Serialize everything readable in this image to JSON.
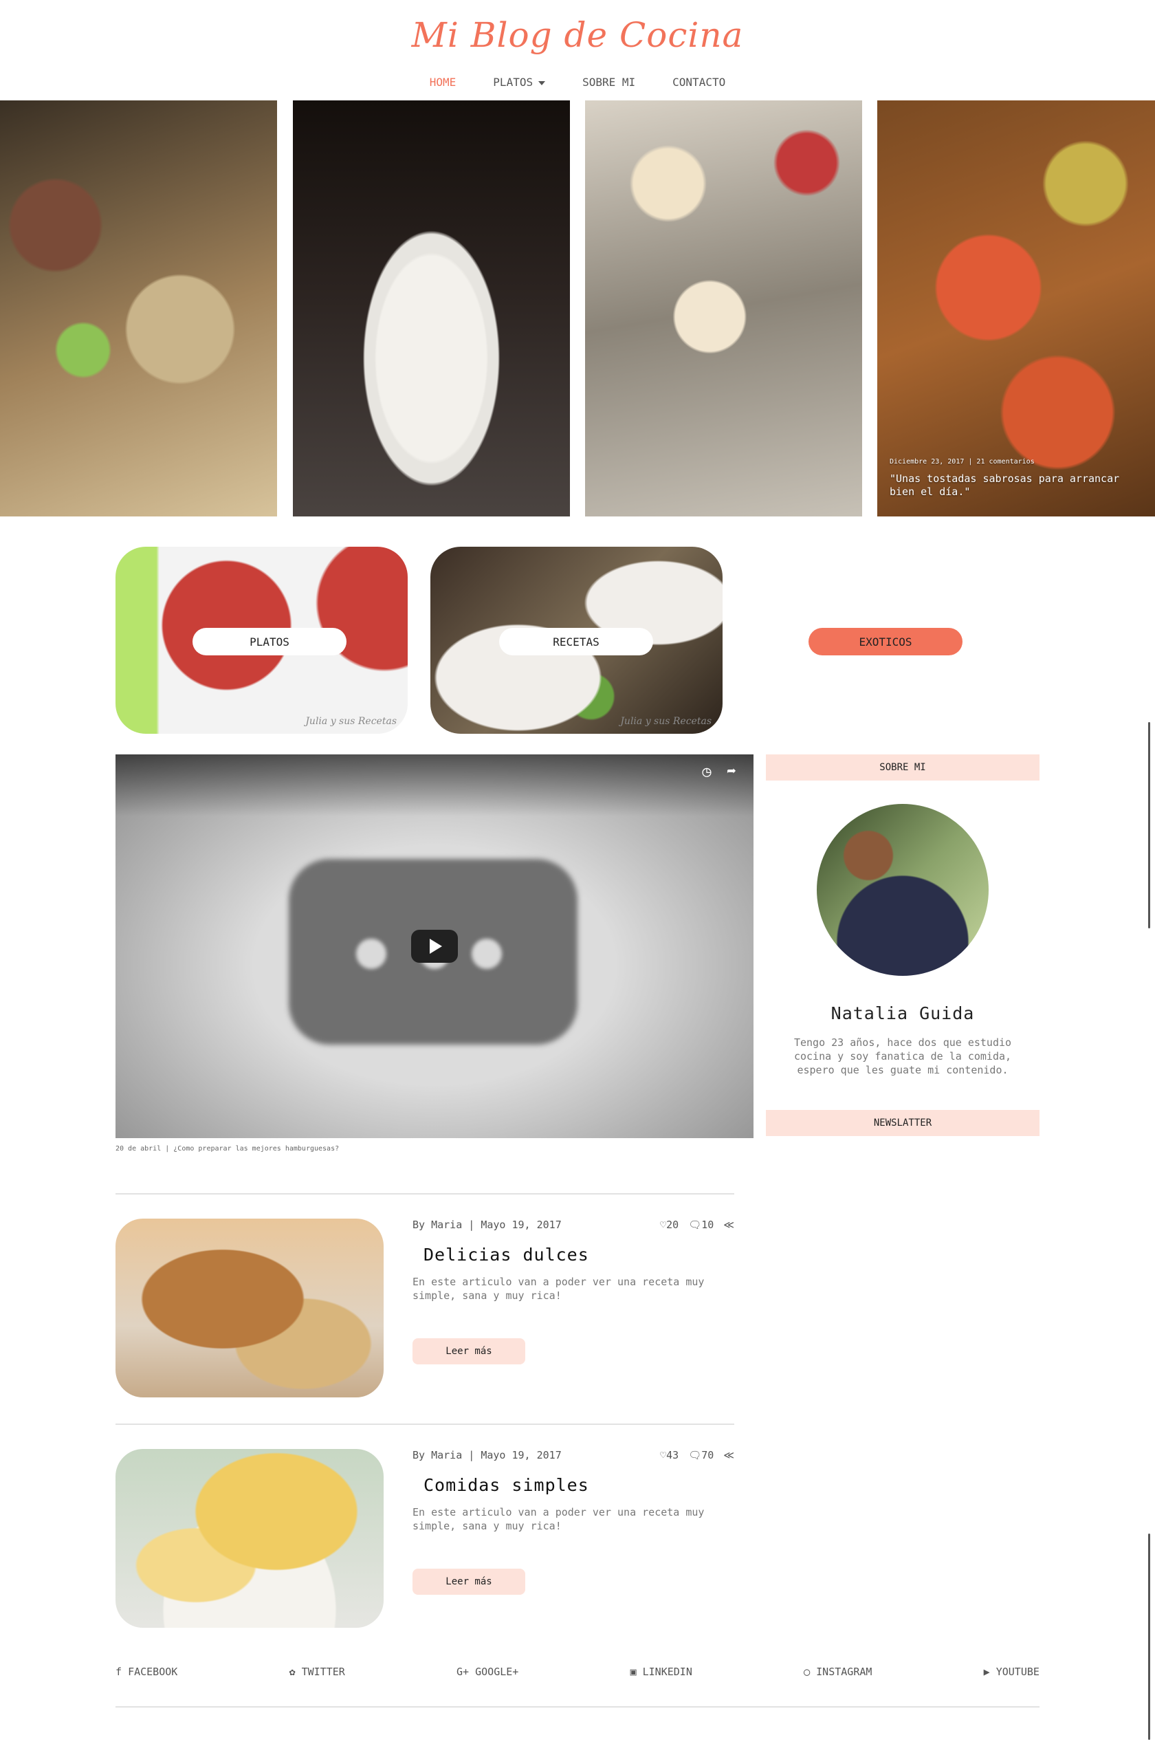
{
  "header": {
    "title": "Mi Blog de Cocina"
  },
  "nav": {
    "home": "HOME",
    "platos": "PLATOS",
    "sobre_mi": "SOBRE MI",
    "contacto": "CONTACTO"
  },
  "hero": {
    "caption_meta": "Diciembre 23, 2017 | 21 comentarios",
    "caption_quote": "\"Unas tostadas sabrosas para arrancar bien el día.\""
  },
  "categories": {
    "platos": "PLATOS",
    "recetas": "RECETAS",
    "exoticos": "EXOTICOS",
    "signature": "Julia y sus Recetas"
  },
  "video": {
    "caption": "20 de abril | ¿Como preparar las mejores hamburguesas?"
  },
  "sidebar": {
    "about_heading": "SOBRE MI",
    "author_name": "Natalia Guida",
    "author_bio": "Tengo 23 años, hace dos que estudio cocina y soy fanatica de la comida, espero que les guate mi contenido.",
    "newsletter_heading": "NEWSLATTER"
  },
  "articles": [
    {
      "meta": "By Maria | Mayo 19, 2017",
      "likes": "20",
      "comments": "10",
      "title": "Delicias dulces",
      "excerpt": "En este articulo van a poder ver una receta muy simple, sana y muy rica!",
      "button": "Leer más"
    },
    {
      "meta": "By Maria | Mayo 19, 2017",
      "likes": "43",
      "comments": "70",
      "title": "Comidas simples",
      "excerpt": "En este articulo van a poder ver una receta muy simple, sana y muy rica!",
      "button": "Leer más"
    }
  ],
  "social": {
    "facebook": "FACEBOOK",
    "twitter": "TWITTER",
    "google": "GOOGLE+",
    "linkedin": "LINKEDIN",
    "instagram": "INSTAGRAM",
    "youtube": "YOUTUBE"
  },
  "colors": {
    "accent": "#f2735a",
    "soft_pink": "#fde2da"
  }
}
